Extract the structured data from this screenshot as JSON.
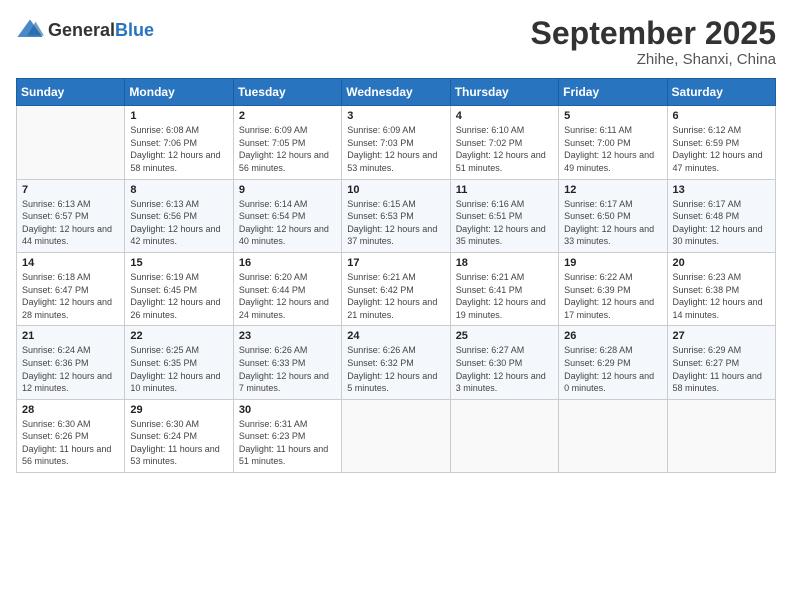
{
  "header": {
    "logo_general": "General",
    "logo_blue": "Blue",
    "month": "September 2025",
    "location": "Zhihe, Shanxi, China"
  },
  "days_of_week": [
    "Sunday",
    "Monday",
    "Tuesday",
    "Wednesday",
    "Thursday",
    "Friday",
    "Saturday"
  ],
  "weeks": [
    [
      {
        "day": "",
        "sunrise": "",
        "sunset": "",
        "daylight": ""
      },
      {
        "day": "1",
        "sunrise": "Sunrise: 6:08 AM",
        "sunset": "Sunset: 7:06 PM",
        "daylight": "Daylight: 12 hours and 58 minutes."
      },
      {
        "day": "2",
        "sunrise": "Sunrise: 6:09 AM",
        "sunset": "Sunset: 7:05 PM",
        "daylight": "Daylight: 12 hours and 56 minutes."
      },
      {
        "day": "3",
        "sunrise": "Sunrise: 6:09 AM",
        "sunset": "Sunset: 7:03 PM",
        "daylight": "Daylight: 12 hours and 53 minutes."
      },
      {
        "day": "4",
        "sunrise": "Sunrise: 6:10 AM",
        "sunset": "Sunset: 7:02 PM",
        "daylight": "Daylight: 12 hours and 51 minutes."
      },
      {
        "day": "5",
        "sunrise": "Sunrise: 6:11 AM",
        "sunset": "Sunset: 7:00 PM",
        "daylight": "Daylight: 12 hours and 49 minutes."
      },
      {
        "day": "6",
        "sunrise": "Sunrise: 6:12 AM",
        "sunset": "Sunset: 6:59 PM",
        "daylight": "Daylight: 12 hours and 47 minutes."
      }
    ],
    [
      {
        "day": "7",
        "sunrise": "Sunrise: 6:13 AM",
        "sunset": "Sunset: 6:57 PM",
        "daylight": "Daylight: 12 hours and 44 minutes."
      },
      {
        "day": "8",
        "sunrise": "Sunrise: 6:13 AM",
        "sunset": "Sunset: 6:56 PM",
        "daylight": "Daylight: 12 hours and 42 minutes."
      },
      {
        "day": "9",
        "sunrise": "Sunrise: 6:14 AM",
        "sunset": "Sunset: 6:54 PM",
        "daylight": "Daylight: 12 hours and 40 minutes."
      },
      {
        "day": "10",
        "sunrise": "Sunrise: 6:15 AM",
        "sunset": "Sunset: 6:53 PM",
        "daylight": "Daylight: 12 hours and 37 minutes."
      },
      {
        "day": "11",
        "sunrise": "Sunrise: 6:16 AM",
        "sunset": "Sunset: 6:51 PM",
        "daylight": "Daylight: 12 hours and 35 minutes."
      },
      {
        "day": "12",
        "sunrise": "Sunrise: 6:17 AM",
        "sunset": "Sunset: 6:50 PM",
        "daylight": "Daylight: 12 hours and 33 minutes."
      },
      {
        "day": "13",
        "sunrise": "Sunrise: 6:17 AM",
        "sunset": "Sunset: 6:48 PM",
        "daylight": "Daylight: 12 hours and 30 minutes."
      }
    ],
    [
      {
        "day": "14",
        "sunrise": "Sunrise: 6:18 AM",
        "sunset": "Sunset: 6:47 PM",
        "daylight": "Daylight: 12 hours and 28 minutes."
      },
      {
        "day": "15",
        "sunrise": "Sunrise: 6:19 AM",
        "sunset": "Sunset: 6:45 PM",
        "daylight": "Daylight: 12 hours and 26 minutes."
      },
      {
        "day": "16",
        "sunrise": "Sunrise: 6:20 AM",
        "sunset": "Sunset: 6:44 PM",
        "daylight": "Daylight: 12 hours and 24 minutes."
      },
      {
        "day": "17",
        "sunrise": "Sunrise: 6:21 AM",
        "sunset": "Sunset: 6:42 PM",
        "daylight": "Daylight: 12 hours and 21 minutes."
      },
      {
        "day": "18",
        "sunrise": "Sunrise: 6:21 AM",
        "sunset": "Sunset: 6:41 PM",
        "daylight": "Daylight: 12 hours and 19 minutes."
      },
      {
        "day": "19",
        "sunrise": "Sunrise: 6:22 AM",
        "sunset": "Sunset: 6:39 PM",
        "daylight": "Daylight: 12 hours and 17 minutes."
      },
      {
        "day": "20",
        "sunrise": "Sunrise: 6:23 AM",
        "sunset": "Sunset: 6:38 PM",
        "daylight": "Daylight: 12 hours and 14 minutes."
      }
    ],
    [
      {
        "day": "21",
        "sunrise": "Sunrise: 6:24 AM",
        "sunset": "Sunset: 6:36 PM",
        "daylight": "Daylight: 12 hours and 12 minutes."
      },
      {
        "day": "22",
        "sunrise": "Sunrise: 6:25 AM",
        "sunset": "Sunset: 6:35 PM",
        "daylight": "Daylight: 12 hours and 10 minutes."
      },
      {
        "day": "23",
        "sunrise": "Sunrise: 6:26 AM",
        "sunset": "Sunset: 6:33 PM",
        "daylight": "Daylight: 12 hours and 7 minutes."
      },
      {
        "day": "24",
        "sunrise": "Sunrise: 6:26 AM",
        "sunset": "Sunset: 6:32 PM",
        "daylight": "Daylight: 12 hours and 5 minutes."
      },
      {
        "day": "25",
        "sunrise": "Sunrise: 6:27 AM",
        "sunset": "Sunset: 6:30 PM",
        "daylight": "Daylight: 12 hours and 3 minutes."
      },
      {
        "day": "26",
        "sunrise": "Sunrise: 6:28 AM",
        "sunset": "Sunset: 6:29 PM",
        "daylight": "Daylight: 12 hours and 0 minutes."
      },
      {
        "day": "27",
        "sunrise": "Sunrise: 6:29 AM",
        "sunset": "Sunset: 6:27 PM",
        "daylight": "Daylight: 11 hours and 58 minutes."
      }
    ],
    [
      {
        "day": "28",
        "sunrise": "Sunrise: 6:30 AM",
        "sunset": "Sunset: 6:26 PM",
        "daylight": "Daylight: 11 hours and 56 minutes."
      },
      {
        "day": "29",
        "sunrise": "Sunrise: 6:30 AM",
        "sunset": "Sunset: 6:24 PM",
        "daylight": "Daylight: 11 hours and 53 minutes."
      },
      {
        "day": "30",
        "sunrise": "Sunrise: 6:31 AM",
        "sunset": "Sunset: 6:23 PM",
        "daylight": "Daylight: 11 hours and 51 minutes."
      },
      {
        "day": "",
        "sunrise": "",
        "sunset": "",
        "daylight": ""
      },
      {
        "day": "",
        "sunrise": "",
        "sunset": "",
        "daylight": ""
      },
      {
        "day": "",
        "sunrise": "",
        "sunset": "",
        "daylight": ""
      },
      {
        "day": "",
        "sunrise": "",
        "sunset": "",
        "daylight": ""
      }
    ]
  ]
}
